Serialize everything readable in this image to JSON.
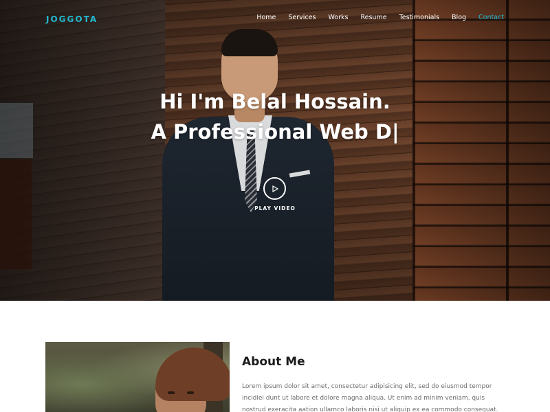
{
  "brand": {
    "logo": "JOGGOTA",
    "accent_color": "#22b8cf"
  },
  "nav": {
    "items": [
      {
        "label": "Home",
        "active": false
      },
      {
        "label": "Services",
        "active": false
      },
      {
        "label": "Works",
        "active": false
      },
      {
        "label": "Resume",
        "active": false
      },
      {
        "label": "Testimonials",
        "active": false
      },
      {
        "label": "Blog",
        "active": false
      },
      {
        "label": "Contact",
        "active": true
      }
    ]
  },
  "hero": {
    "line1": "Hi I'm Belal Hossain.",
    "line2": "A Professional Web D|",
    "play_icon": "play-icon",
    "play_label": "PLAY VIDEO"
  },
  "about": {
    "title": "About Me",
    "text": "Lorem ipsum dolor sit amet, consectetur adipisicing elit, sed do eiusmod tempor incidiei dunt ut labore et dolore magna aliqua. Ut enim ad minim veniam, quis nostrud exeracita aation ullamco laboris nisi ut aliquip ex ea commodo consequat. Duis aute irure dolor in reprehenderit in"
  }
}
